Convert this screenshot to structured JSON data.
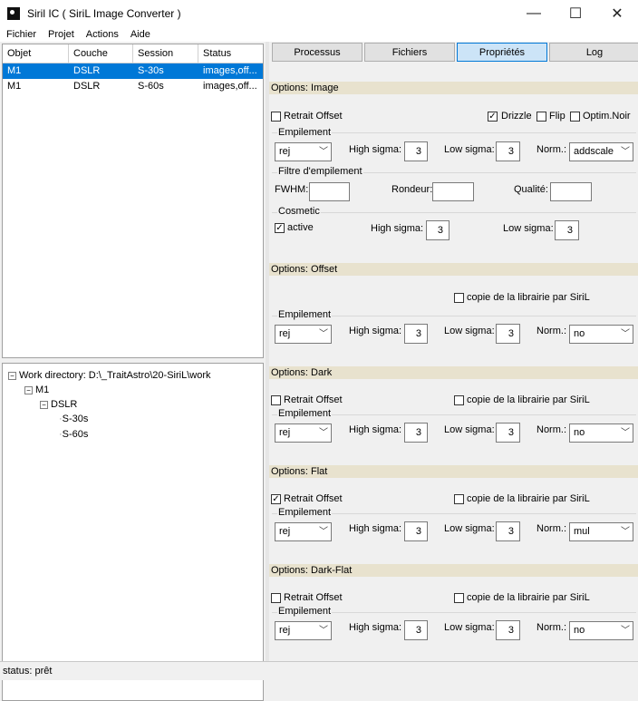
{
  "window": {
    "title": "Siril IC  ( SiriL Image Converter )",
    "min": "—",
    "max": "☐",
    "close": "✕"
  },
  "menu": [
    "Fichier",
    "Projet",
    "Actions",
    "Aide"
  ],
  "grid": {
    "headers": [
      "Objet",
      "Couche",
      "Session",
      "Status"
    ],
    "rows": [
      [
        "M1",
        "DSLR",
        "S-30s",
        "images,off..."
      ],
      [
        "M1",
        "DSLR",
        "S-60s",
        "images,off..."
      ]
    ]
  },
  "tree": {
    "root": "Work directory: D:\\_TraitAstro\\20-SiriL\\work",
    "object": "M1",
    "layer": "DSLR",
    "sessions": [
      "S-30s",
      "S-60s"
    ]
  },
  "tabs": [
    "Processus",
    "Fichiers",
    "Propriétés",
    "Log"
  ],
  "active_tab": "Propriétés",
  "labels": {
    "retrait_offset": "Retrait Offset",
    "empilement": "Empilement",
    "high_sigma": "High sigma:",
    "low_sigma": "Low sigma:",
    "norm": "Norm.:",
    "copie": "copie de la librairie par SiriL"
  },
  "image": {
    "header": "Options: Image",
    "drizzle": "Drizzle",
    "flip": "Flip",
    "optim_noir": "Optim.Noir",
    "method": "rej",
    "high": "3",
    "low": "3",
    "norm": "addscale",
    "filtre_header": "Filtre d'empilement",
    "fwhm": "FWHM:",
    "rondeur": "Rondeur:",
    "qualite": "Qualité:",
    "cosmetic_header": "Cosmetic",
    "active": "active",
    "cos_high": "3",
    "cos_low": "3"
  },
  "offset": {
    "header": "Options: Offset",
    "method": "rej",
    "high": "3",
    "low": "3",
    "norm": "no"
  },
  "dark": {
    "header": "Options: Dark",
    "method": "rej",
    "high": "3",
    "low": "3",
    "norm": "no"
  },
  "flat": {
    "header": "Options: Flat",
    "method": "rej",
    "high": "3",
    "low": "3",
    "norm": "mul"
  },
  "darkflat": {
    "header": "Options: Dark-Flat",
    "method": "rej",
    "high": "3",
    "low": "3",
    "norm": "no"
  },
  "status": "status: prêt"
}
